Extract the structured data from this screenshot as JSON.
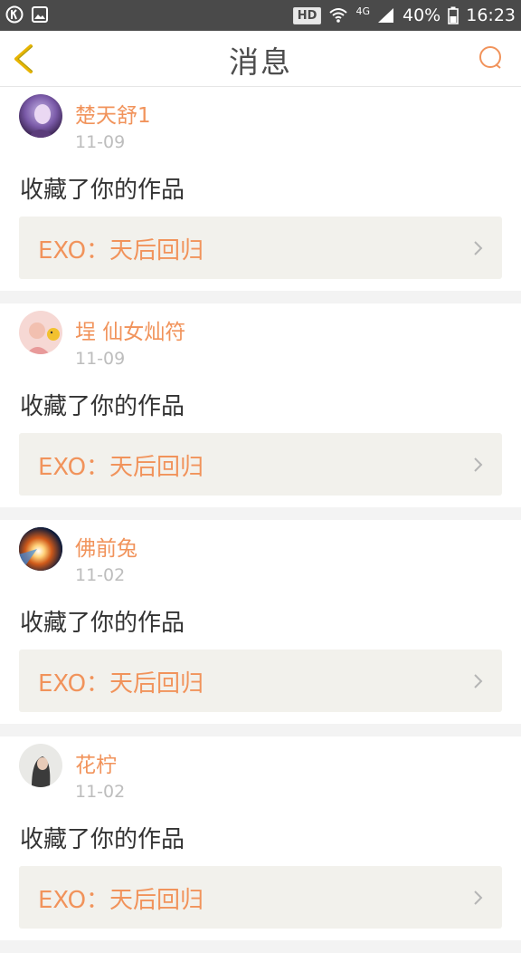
{
  "status_bar": {
    "hd": "HD",
    "network": "4G",
    "battery": "40%",
    "time": "16:23"
  },
  "header": {
    "title": "消息",
    "back_icon": "chevron-left-icon",
    "chat_icon": "chat-bubble-icon"
  },
  "colors": {
    "accent": "#f1935b",
    "back_arrow": "#e8b400",
    "status_bar": "#4a4a4a"
  },
  "messages": [
    {
      "user": "楚天舒1",
      "date": "11-09",
      "action": "收藏了你的作品",
      "work": "EXO：天后回归"
    },
    {
      "user": "埕 仙女灿符",
      "date": "11-09",
      "action": "收藏了你的作品",
      "work": "EXO：天后回归"
    },
    {
      "user": "佛前兔",
      "date": "11-02",
      "action": "收藏了你的作品",
      "work": "EXO：天后回归"
    },
    {
      "user": "花柠",
      "date": "11-02",
      "action": "收藏了你的作品",
      "work": "EXO：天后回归"
    }
  ]
}
